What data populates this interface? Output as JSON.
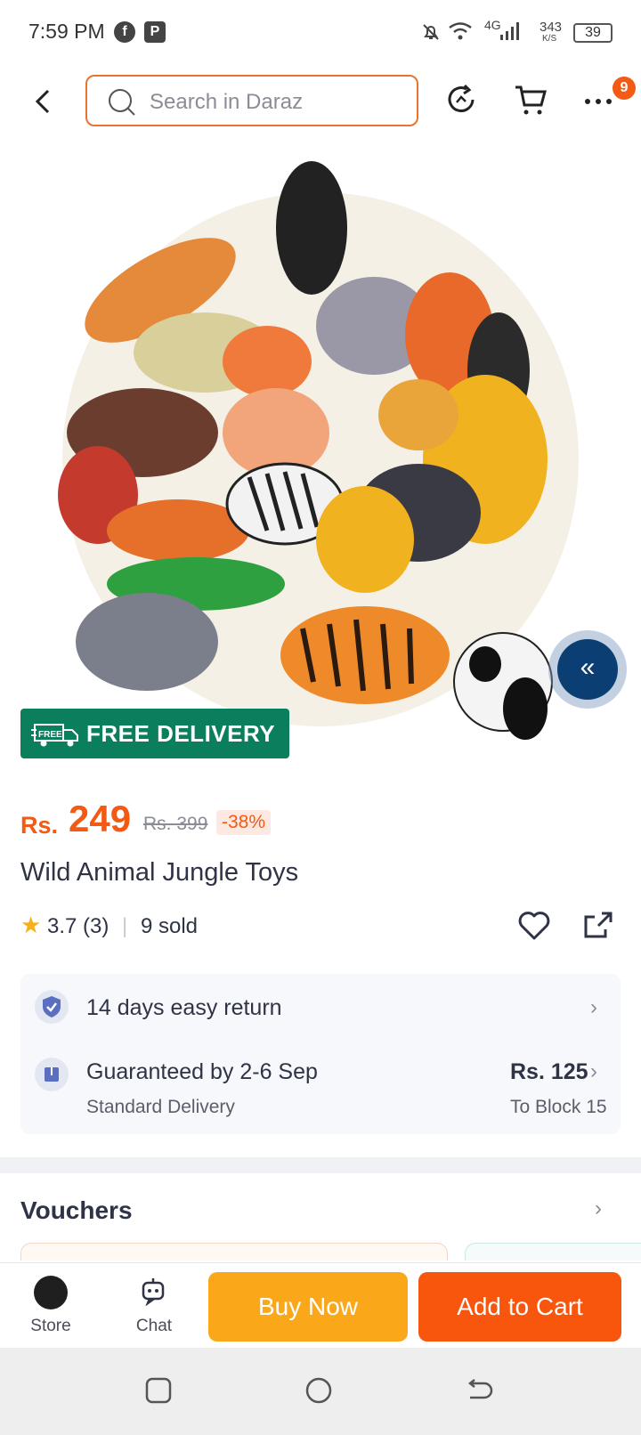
{
  "status_bar": {
    "time": "7:59 PM",
    "network": "4G",
    "speed_value": "343",
    "speed_unit": "K/S",
    "battery": "39"
  },
  "header": {
    "search_placeholder": "Search in Daraz",
    "more_badge": "9"
  },
  "product": {
    "free_delivery_tag": "FREE",
    "free_delivery_label": "FREE DELIVERY",
    "currency": "Rs.",
    "price": "249",
    "original_price": "Rs. 399",
    "discount": "-38%",
    "title": "Wild Animal Jungle Toys",
    "rating": "3.7",
    "rating_count": "(3)",
    "sold": "9 sold"
  },
  "services": {
    "return_label": "14 days easy return",
    "delivery_label": "Guaranteed by 2-6 Sep",
    "delivery_type": "Standard Delivery",
    "delivery_fee": "Rs. 125",
    "delivery_location": "To Block 15"
  },
  "vouchers": {
    "title": "Vouchers"
  },
  "action_bar": {
    "store_label": "Store",
    "chat_label": "Chat",
    "buy_now_label": "Buy Now",
    "add_to_cart_label": "Add to Cart"
  },
  "colors": {
    "brand_orange": "#f35a13",
    "buy_now": "#fba71a",
    "add_to_cart": "#f8550d",
    "free_delivery_bg": "#0b7e5e"
  }
}
